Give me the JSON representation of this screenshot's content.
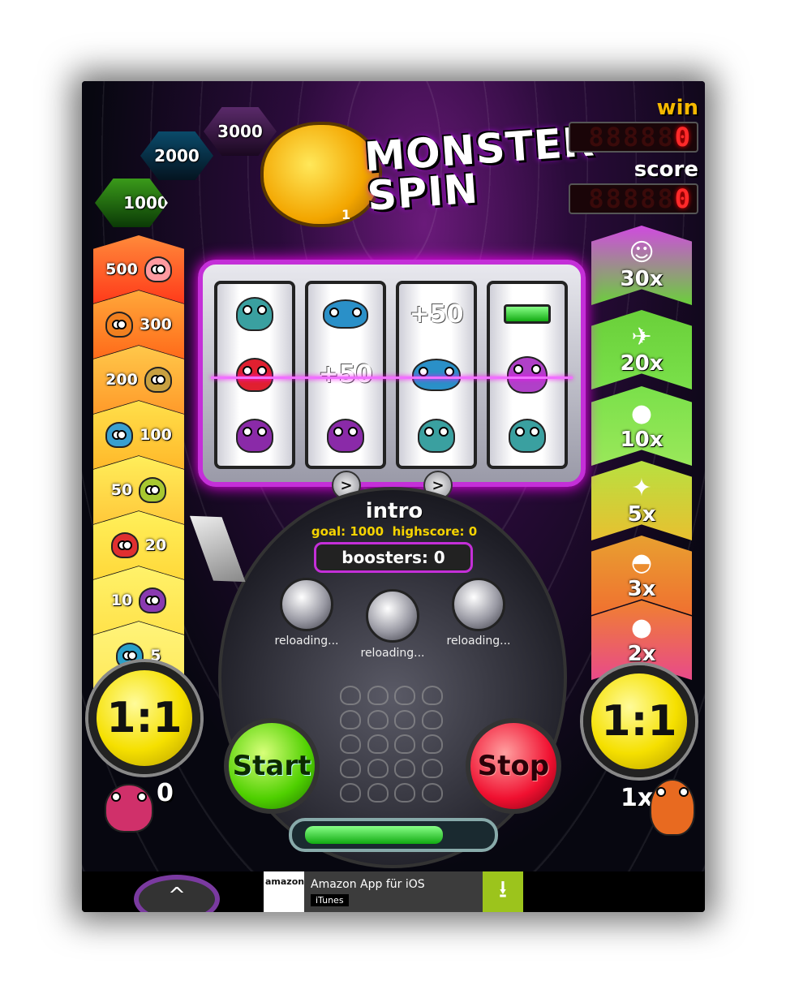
{
  "title": "MONSTER SPIN",
  "logo_number": "1",
  "levels": [
    "1000",
    "2000",
    "3000"
  ],
  "counters": {
    "win_label": "win",
    "win_value": "0",
    "win_dim": "88888",
    "score_label": "score",
    "score_value": "0",
    "score_dim": "88888"
  },
  "paytable_left": [
    "500",
    "300",
    "200",
    "100",
    "50",
    "20",
    "10",
    "5"
  ],
  "multipliers_right": [
    "30x",
    "20x",
    "10x",
    "5x",
    "3x",
    "2x"
  ],
  "reels": [
    [
      "monster-green",
      "monster-red",
      "monster-purple"
    ],
    [
      "monster-blue",
      "+50",
      "monster-purple"
    ],
    [
      "+50",
      "monster-blue",
      "monster-green"
    ],
    [
      "battery",
      "monster-purple",
      "monster-green"
    ]
  ],
  "hold_arrow": ">",
  "status": {
    "mode": "intro",
    "goal": "goal: 1000",
    "highscore": "highscore: 0",
    "boosters": "boosters: 0"
  },
  "booster_slots": [
    "reloading...",
    "reloading...",
    "reloading..."
  ],
  "buttons": {
    "start": "Start",
    "stop": "Stop"
  },
  "ratio_left": "1:1",
  "ratio_right": "1:1",
  "left_count": "0",
  "right_mult": "1x",
  "power_level": 0.78,
  "ad": {
    "brand": "amazon",
    "title": "Amazon App für iOS",
    "tag": "iTunes",
    "download_icon": "download-icon"
  },
  "up_icon": "^",
  "colors": {
    "accent": "#c42fd8",
    "start": "#4fd000",
    "stop": "#f01030",
    "ratio": "#f5e000",
    "win": "#f5b800"
  }
}
